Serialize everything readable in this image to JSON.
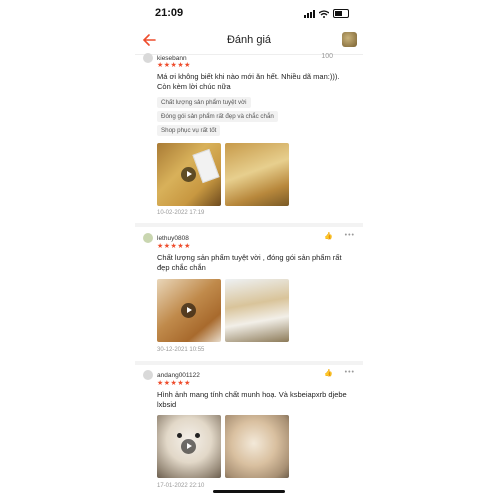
{
  "status": {
    "time": "21:09"
  },
  "header": {
    "title": "Đánh giá"
  },
  "reviews": [
    {
      "user": "kiesebann",
      "like": "100",
      "stars": "★★★★★",
      "text": "Má ơi không biết khi nào mới ăn hết. Nhiều dã man:))). Còn kèm lời chúc nữa",
      "tags": [
        "Chất lượng sản phẩm tuyệt vời",
        "Đóng gói sản phẩm rất đẹp và chắc chắn",
        "Shop phục vụ rất tốt"
      ],
      "date": "10-02-2022 17:19"
    },
    {
      "user": "lethuy0808",
      "stars": "★★★★★",
      "text": "Chất lượng sản phẩm tuyệt vời , đóng gói sản phẩm rất đẹp chắc chắn",
      "date": "30-12-2021 10:55"
    },
    {
      "user": "andang001122",
      "stars": "★★★★★",
      "text": "Hình ảnh mang tính chất munh hoạ. Và ksbeiapxrb djebe lxbsid",
      "date": "17-01-2022 22:10"
    }
  ],
  "colors": {
    "accent": "#ee4d2d"
  }
}
